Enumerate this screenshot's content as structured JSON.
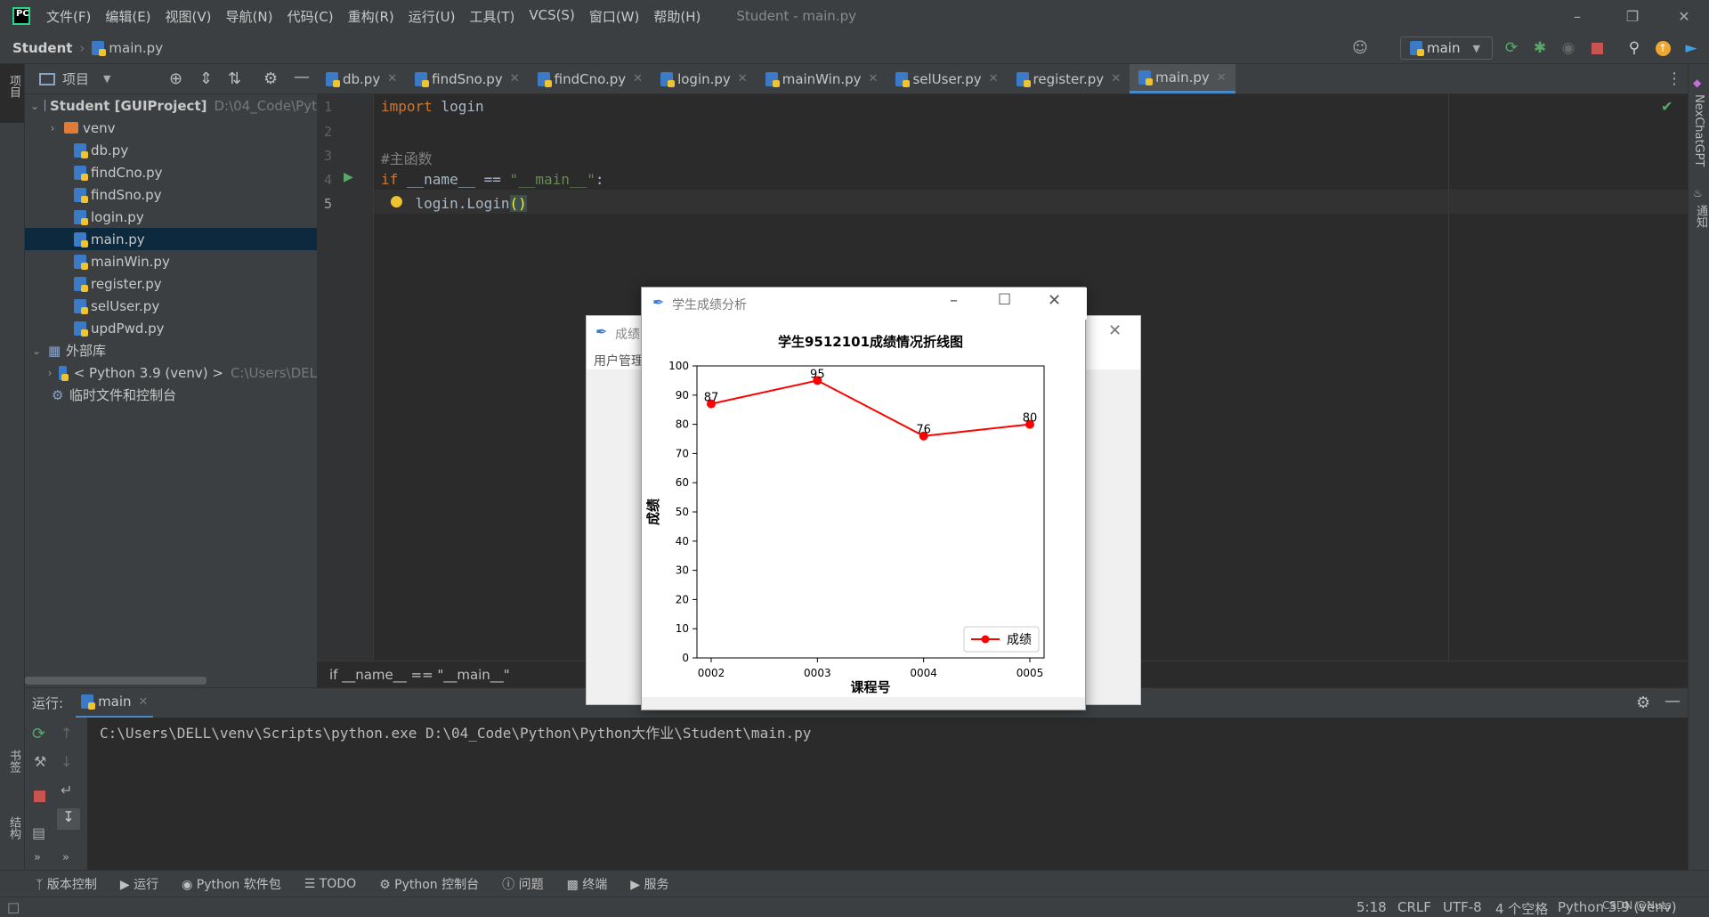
{
  "titlebar": {
    "menus": [
      "文件(F)",
      "编辑(E)",
      "视图(V)",
      "导航(N)",
      "代码(C)",
      "重构(R)",
      "运行(U)",
      "工具(T)",
      "VCS(S)",
      "窗口(W)",
      "帮助(H)"
    ],
    "window_title": "Student - main.py"
  },
  "navbar": {
    "project": "Student",
    "file": "main.py",
    "run_config": "main"
  },
  "project_panel": {
    "title": "项目",
    "strip_label": "项目",
    "root_name": "Student [GUIProject]",
    "root_path": "D:\\04_Code\\Pyt",
    "venv": "venv",
    "files": [
      "db.py",
      "findCno.py",
      "findSno.py",
      "login.py",
      "main.py",
      "mainWin.py",
      "register.py",
      "selUser.py",
      "updPwd.py"
    ],
    "external_libs": "外部库",
    "python_sdk": "< Python 3.9 (venv) >",
    "python_sdk_path": "C:\\Users\\DEL",
    "scratches": "临时文件和控制台"
  },
  "tabs": [
    "db.py",
    "findSno.py",
    "findCno.py",
    "login.py",
    "mainWin.py",
    "selUser.py",
    "register.py",
    "main.py"
  ],
  "editor": {
    "line_numbers": [
      "1",
      "2",
      "3",
      "4",
      "5"
    ],
    "breadcrumb": "if __name__ == \"__main__\""
  },
  "right_strip": {
    "plugin": "NexChatGPT",
    "notifications": "通知"
  },
  "left_bottom_strip": {
    "bookmarks": "书签",
    "structure": "结构"
  },
  "run_panel": {
    "label": "运行:",
    "tab": "main",
    "command": "C:\\Users\\DELL\\venv\\Scripts\\python.exe D:\\04_Code\\Python\\Python大作业\\Student\\main.py"
  },
  "bottom_tools": [
    "版本控制",
    "运行",
    "Python 软件包",
    "TODO",
    "Python 控制台",
    "问题",
    "终端",
    "服务"
  ],
  "status": {
    "position": "5:18",
    "line_sep": "CRLF",
    "encoding": "UTF-8",
    "indent": "4 个空格",
    "interpreter": "Python 3.9 (venv)",
    "watermark": "CSDN @Nuts"
  },
  "back_dialog": {
    "title": "成绩",
    "menu": "用户管理"
  },
  "chart_window": {
    "title": "学生成绩分析"
  },
  "chart_data": {
    "type": "line",
    "title": "学生9512101成绩情况折线图",
    "xlabel": "课程号",
    "ylabel": "成绩",
    "categories": [
      "0002",
      "0003",
      "0004",
      "0005"
    ],
    "series": [
      {
        "name": "成绩",
        "values": [
          87,
          95,
          76,
          80
        ],
        "color": "#ff0000"
      }
    ],
    "ylim": [
      0,
      100
    ],
    "yticks": [
      0,
      10,
      20,
      30,
      40,
      50,
      60,
      70,
      80,
      90,
      100
    ],
    "legend": "lower-right",
    "grid": false
  }
}
